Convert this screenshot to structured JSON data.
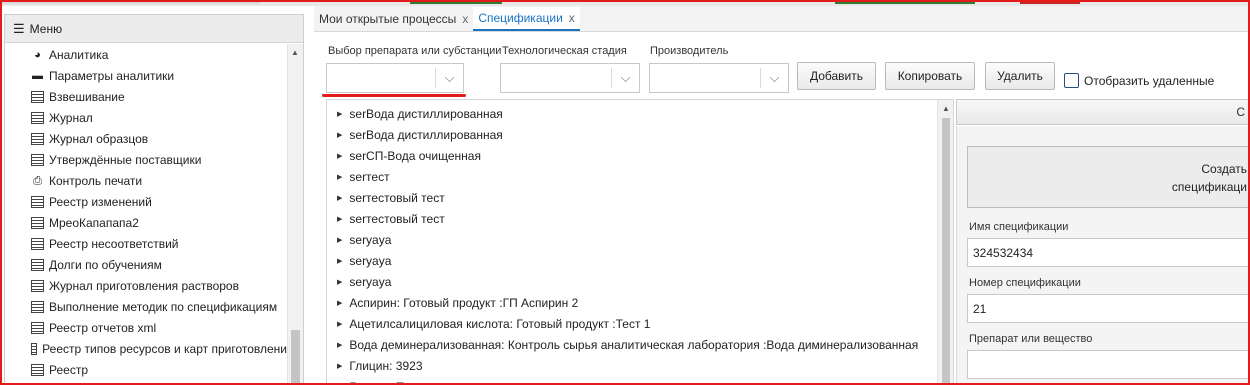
{
  "sidebar": {
    "title": "Меню",
    "items": [
      {
        "label": "Аналитика",
        "icon": "pie-chart-icon"
      },
      {
        "label": "Параметры аналитики",
        "icon": "toolbox-icon"
      },
      {
        "label": "Взвешивание",
        "icon": "table-icon"
      },
      {
        "label": "Журнал",
        "icon": "table-icon"
      },
      {
        "label": "Журнал образцов",
        "icon": "table-icon"
      },
      {
        "label": "Утверждённые поставщики",
        "icon": "table-icon"
      },
      {
        "label": "Контроль печати",
        "icon": "printer-icon"
      },
      {
        "label": "Реестр изменений",
        "icon": "table-icon"
      },
      {
        "label": "МрeoКапапапа2",
        "icon": "table-icon"
      },
      {
        "label": "Реестр несоответствий",
        "icon": "table-icon"
      },
      {
        "label": "Долги по обучениям",
        "icon": "table-icon"
      },
      {
        "label": "Журнал приготовления растворов",
        "icon": "table-icon"
      },
      {
        "label": "Выполнение методик по спецификациям",
        "icon": "table-icon"
      },
      {
        "label": "Реестр отчетов xml",
        "icon": "table-icon"
      },
      {
        "label": "Реестр типов ресурсов и карт приготовлени",
        "icon": "table-icon"
      },
      {
        "label": "Реестр",
        "icon": "table-icon"
      }
    ]
  },
  "tabs": [
    {
      "label": "Мои открытые процессы",
      "close": "x",
      "active": false
    },
    {
      "label": "Спецификации",
      "close": "x",
      "active": true
    }
  ],
  "filters": {
    "substance_label": "Выбор препарата или субстанции",
    "stage_label": "Технологическая стадия",
    "manufacturer_label": "Производитель",
    "add_button": "Добавить",
    "copy_button": "Копировать",
    "delete_button": "Удалить",
    "show_deleted_label": "Отобразить удаленные",
    "show_deleted_checked": false
  },
  "tree_items": [
    "serВода дистиллированная",
    "serВода дистиллированная",
    "serСП-Вода очищенная",
    "serтест",
    "serтестовый тест",
    "serтестовый тест",
    "seryaya",
    "seryaya",
    "seryaya",
    "Аспирин: Готовый продукт :ГП Аспирин 2",
    "Ацетилсалициловая кислота: Готовый продукт :Тест 1",
    "Вода деминерализованная: Контроль сырья аналитическая лаборатория :Вода диминерализованная",
    "Глицин: 3923",
    "Глицин: Простая"
  ],
  "right_panel": {
    "header_text": "С",
    "create_line1": "Создать",
    "create_line2": "спецификаци",
    "name_label": "Имя спецификации",
    "name_value": "324532434",
    "number_label": "Номер спецификации",
    "number_value": "21",
    "substance_label": "Препарат или вещество",
    "substance_value": ""
  },
  "colors": {
    "accent": "#1a73c4",
    "annotation_red": "#e51b1b"
  }
}
